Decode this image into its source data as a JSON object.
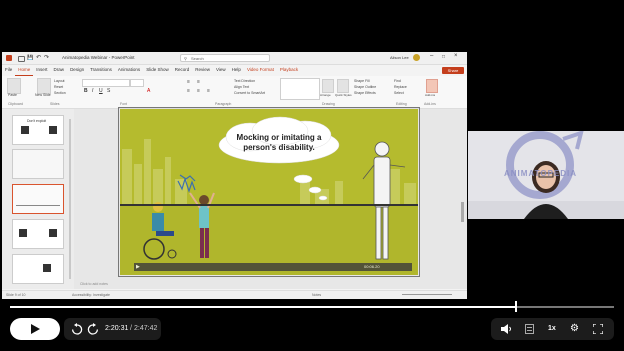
{
  "ppt": {
    "filename": "Animatopedia Webinar",
    "app": "PowerPoint",
    "title_sep": " - ",
    "search_placeholder": "Search",
    "user": "Alison Lee",
    "share_label": "Share",
    "menu": [
      "File",
      "Home",
      "Insert",
      "Draw",
      "Design",
      "Transitions",
      "Animations",
      "Slide Show",
      "Record",
      "Review",
      "View",
      "Help",
      "Video Format",
      "Playback"
    ],
    "ribbon_groups": [
      "Clipboard",
      "Slides",
      "Font",
      "Paragraph",
      "Drawing",
      "Editing",
      "Add-ins"
    ],
    "ribbon_buttons": {
      "paste": "Paste",
      "new_slide": "New Slide",
      "layout": "Layout",
      "reset": "Reset",
      "section": "Section",
      "shape_fill": "Shape Fill",
      "shape_outline": "Shape Outline",
      "shape_effects": "Shape Effects",
      "arrange": "Arrange",
      "quick_styles": "Quick Styles",
      "find": "Find",
      "replace": "Replace",
      "select": "Select",
      "add_ins": "Add-ins",
      "text_direction": "Text Direction",
      "align_text": "Align Text",
      "convert": "Convert to SmartArt"
    },
    "thumbnails": [
      {
        "num": "",
        "label": "Don't exploit"
      },
      {
        "num": "",
        "label": ""
      },
      {
        "num": "",
        "label": ""
      },
      {
        "num": "",
        "label": ""
      },
      {
        "num": "",
        "label": ""
      }
    ],
    "slide": {
      "speech_line1": "Mocking or imitating a",
      "speech_line2": "person's disability."
    },
    "notes_placeholder": "Click to add notes",
    "video_time": "00:06.20",
    "status_left": "Slide 9 of 10",
    "status_accessibility": "Accessibility: Investigate",
    "status_notes": "Notes"
  },
  "webcam": {
    "logo_text": "ANIMATOPEDIA"
  },
  "player": {
    "current_time": "2:20:31",
    "separator": "/",
    "total_time": "2:47:42",
    "progress_fraction": 0.837,
    "speed_label": "1x"
  }
}
